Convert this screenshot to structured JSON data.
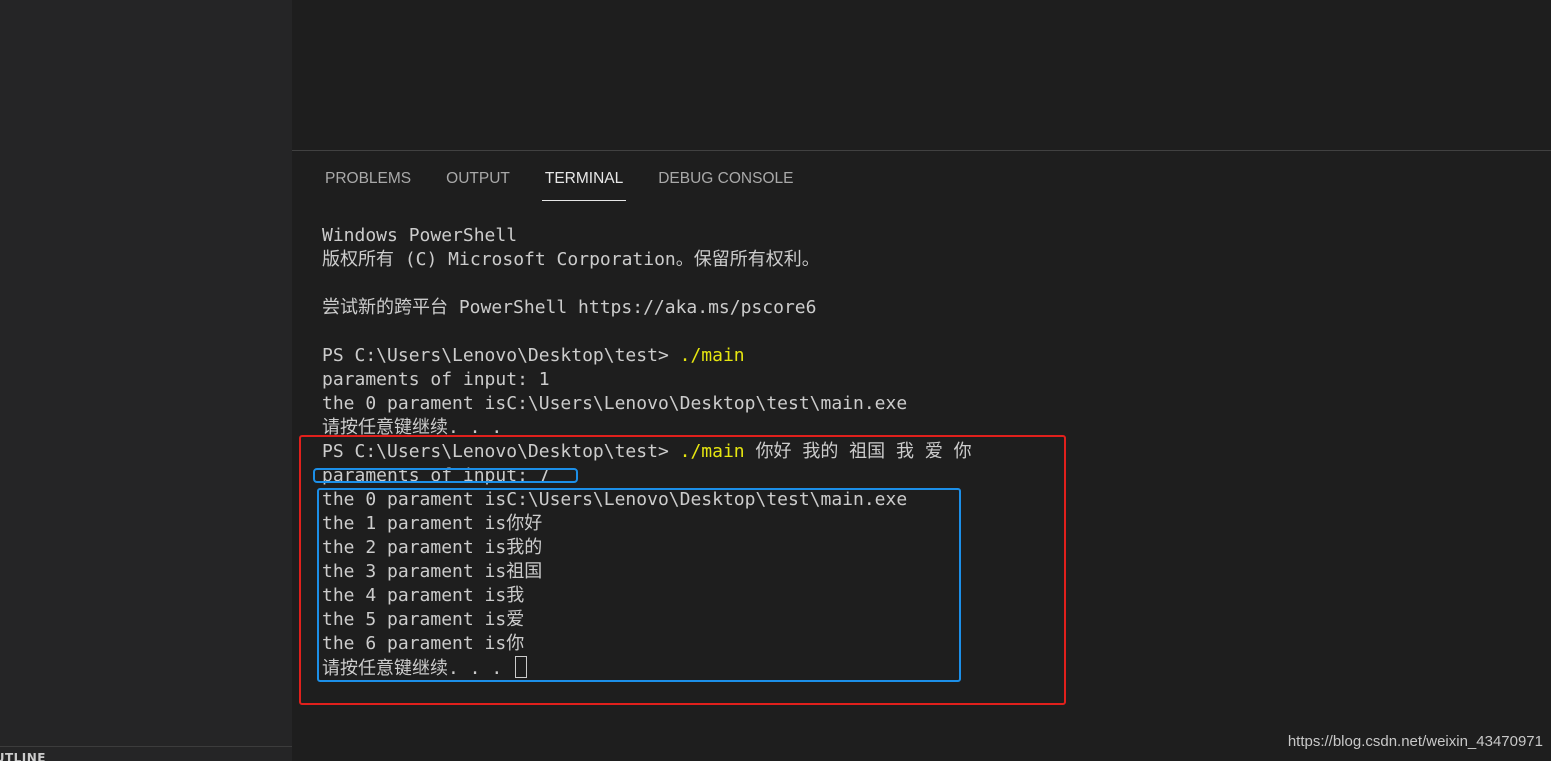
{
  "sidebar": {
    "outline_label": "OUTLINE"
  },
  "panel": {
    "tabs": [
      {
        "label": "PROBLEMS",
        "active": false
      },
      {
        "label": "OUTPUT",
        "active": false
      },
      {
        "label": "TERMINAL",
        "active": true
      },
      {
        "label": "DEBUG CONSOLE",
        "active": false
      }
    ]
  },
  "terminal": {
    "lines": [
      {
        "text": "Windows PowerShell",
        "cmd": ""
      },
      {
        "text": "版权所有 (C) Microsoft Corporation。保留所有权利。",
        "cmd": ""
      },
      {
        "text": "",
        "cmd": ""
      },
      {
        "text": "尝试新的跨平台 PowerShell https://aka.ms/pscore6",
        "cmd": ""
      },
      {
        "text": "",
        "cmd": ""
      },
      {
        "text": "PS C:\\Users\\Lenovo\\Desktop\\test> ",
        "cmd": "./main",
        "args": ""
      },
      {
        "text": "paraments of input: 1",
        "cmd": ""
      },
      {
        "text": "the 0 parament isC:\\Users\\Lenovo\\Desktop\\test\\main.exe",
        "cmd": ""
      },
      {
        "text": "请按任意键继续. . .",
        "cmd": ""
      },
      {
        "text": "PS C:\\Users\\Lenovo\\Desktop\\test> ",
        "cmd": "./main",
        "args": " 你好 我的 祖国 我 爱 你"
      },
      {
        "text": "paraments of input: 7",
        "cmd": ""
      },
      {
        "text": "the 0 parament isC:\\Users\\Lenovo\\Desktop\\test\\main.exe",
        "cmd": ""
      },
      {
        "text": "the 1 parament is你好",
        "cmd": ""
      },
      {
        "text": "the 2 parament is我的",
        "cmd": ""
      },
      {
        "text": "the 3 parament is祖国",
        "cmd": ""
      },
      {
        "text": "the 4 parament is我",
        "cmd": ""
      },
      {
        "text": "the 5 parament is爱",
        "cmd": ""
      },
      {
        "text": "the 6 parament is你",
        "cmd": ""
      },
      {
        "text": "请按任意键继续. . . ",
        "cmd": "",
        "cursor": true
      }
    ]
  },
  "colors": {
    "background": "#1e1e1e",
    "sidebar": "#252526",
    "command": "#e5e510",
    "text": "#cccccc",
    "annotation_red": "#e0201c",
    "annotation_blue": "#1c8fe8"
  },
  "watermark": "https://blog.csdn.net/weixin_43470971"
}
